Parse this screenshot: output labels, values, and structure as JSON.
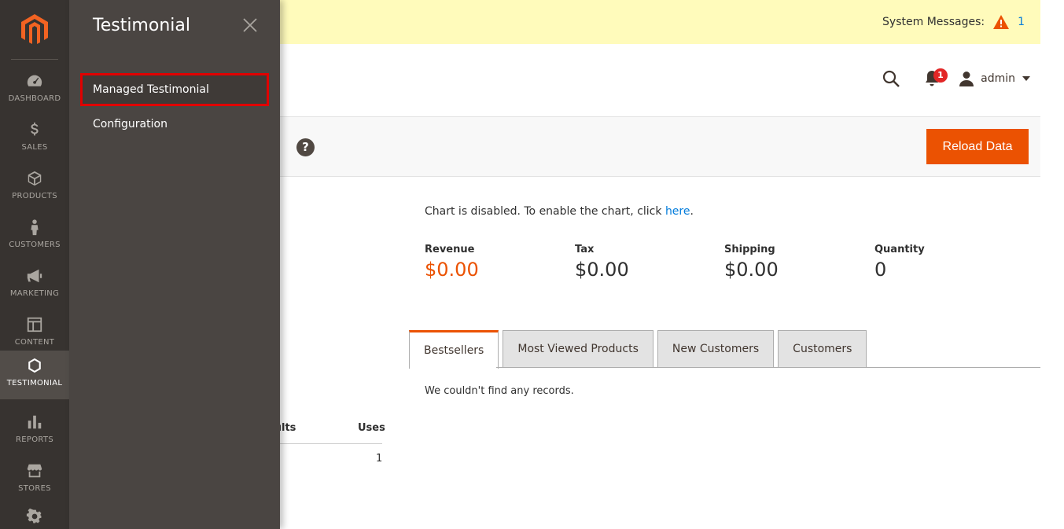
{
  "nav": {
    "items": [
      {
        "label": "DASHBOARD",
        "icon": "dashboard-icon"
      },
      {
        "label": "SALES",
        "icon": "dollar-icon"
      },
      {
        "label": "PRODUCTS",
        "icon": "box-icon"
      },
      {
        "label": "CUSTOMERS",
        "icon": "person-icon"
      },
      {
        "label": "MARKETING",
        "icon": "megaphone-icon"
      },
      {
        "label": "CONTENT",
        "icon": "layout-icon"
      },
      {
        "label": "TESTIMONIAL",
        "icon": "hexagon-icon"
      },
      {
        "label": "REPORTS",
        "icon": "bar-chart-icon"
      },
      {
        "label": "STORES",
        "icon": "store-icon"
      }
    ]
  },
  "flyout": {
    "title": "Testimonial",
    "items": [
      "Managed Testimonial",
      "Configuration"
    ]
  },
  "system": {
    "label": "System Messages:",
    "count": "1"
  },
  "header": {
    "notifications": "1",
    "user": "admin"
  },
  "toolbar": {
    "reload_label": "Reload Data"
  },
  "chart": {
    "message": "Chart is disabled. To enable the chart, click ",
    "link": "here",
    "period": "."
  },
  "stats": [
    {
      "label": "Revenue",
      "value": "$0.00"
    },
    {
      "label": "Tax",
      "value": "$0.00"
    },
    {
      "label": "Shipping",
      "value": "$0.00"
    },
    {
      "label": "Quantity",
      "value": "0"
    }
  ],
  "tabs": [
    "Bestsellers",
    "Most Viewed Products",
    "New Customers",
    "Customers"
  ],
  "empty": "We couldn't find any records.",
  "table": {
    "col_results": "sults",
    "col_uses": "Uses",
    "row_uses": "1"
  },
  "colors": {
    "accent": "#eb5202",
    "nav_bg": "#373330",
    "flyout_bg": "#4a4542",
    "sysbar": "#fffbbb",
    "link": "#007bdb"
  }
}
